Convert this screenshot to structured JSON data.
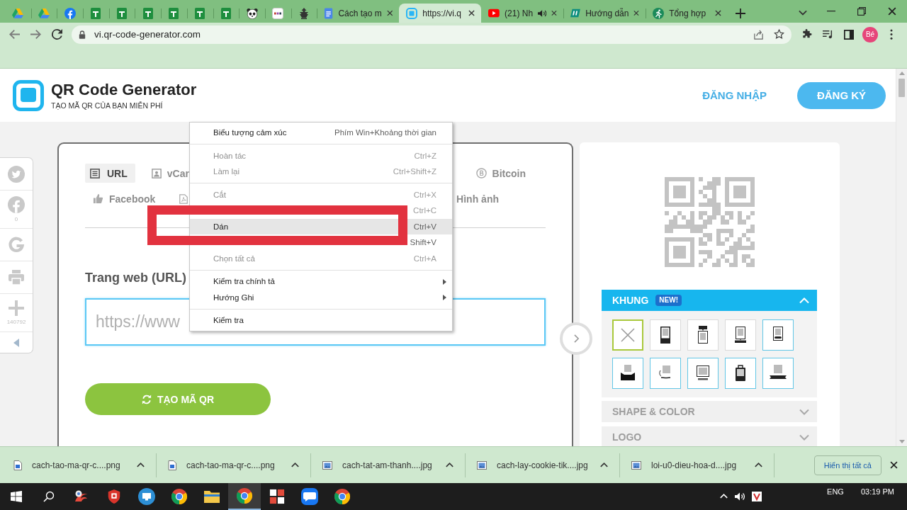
{
  "browser": {
    "tabs": [
      {
        "selected": false,
        "audio": false
      },
      {
        "selected": false,
        "audio": false
      },
      {
        "selected": false,
        "audio": false
      },
      {
        "selected": false,
        "audio": false
      },
      {
        "selected": false,
        "audio": false
      },
      {
        "selected": false,
        "audio": false
      },
      {
        "selected": false,
        "audio": false
      },
      {
        "selected": false,
        "audio": false
      },
      {
        "selected": false,
        "audio": false
      },
      {
        "selected": false,
        "audio": false
      },
      {
        "selected": false,
        "audio": false
      },
      {
        "selected": false,
        "audio": false
      },
      {
        "title": "Cách tạo m",
        "selected": false,
        "audio": false
      },
      {
        "title": "https://vi.q",
        "selected": true,
        "audio": false
      },
      {
        "title": "(21) Nh",
        "selected": false,
        "audio": true
      },
      {
        "title": "Hướng dẫn",
        "selected": false,
        "audio": false
      },
      {
        "title": "Tổng hợp",
        "selected": false,
        "audio": false
      }
    ],
    "address": "vi.qr-code-generator.com",
    "profile": "Bé"
  },
  "site": {
    "title": "QR Code Generator",
    "tagline": "TẠO MÃ QR CỦA BẠN MIỄN PHÍ",
    "login": "ĐĂNG NHẬP",
    "signup": "ĐĂNG KÝ"
  },
  "share_bar": [
    {
      "kind": "share"
    },
    {
      "kind": "share",
      "count": "0"
    },
    {
      "kind": "share"
    },
    {
      "kind": "share"
    },
    {
      "kind": "share",
      "count": "140792"
    },
    {
      "kind": "toggle"
    }
  ],
  "generator": {
    "types": [
      {
        "label": "URL",
        "selected": true
      },
      {
        "label": "vCar",
        "selected": false
      },
      {
        "label": "Bitcoin",
        "selected": false
      },
      {
        "label": "Facebook",
        "selected": false
      },
      {
        "selected": false
      },
      {
        "label": "Hình ảnh",
        "selected": false
      }
    ],
    "field_label": "Trang web (URL)",
    "url_field": {
      "placeholder": "https://www"
    },
    "submit": "TẠO MÃ QR"
  },
  "frames": {
    "title": "KHUNG",
    "badge": "NEW!",
    "expanded": true,
    "options": [
      {
        "kind": "none",
        "selected": true,
        "highlighted": false
      },
      {
        "kind": "frame",
        "selected": false,
        "highlighted": false
      },
      {
        "kind": "frame",
        "selected": false,
        "highlighted": false
      },
      {
        "kind": "frame",
        "selected": false,
        "highlighted": false
      },
      {
        "kind": "frame",
        "selected": false,
        "highlighted": true
      },
      {
        "kind": "frame",
        "selected": false,
        "highlighted": true
      },
      {
        "kind": "frame",
        "selected": false,
        "highlighted": true
      },
      {
        "kind": "frame",
        "selected": false,
        "highlighted": true
      },
      {
        "kind": "frame",
        "selected": false,
        "highlighted": true
      },
      {
        "kind": "frame",
        "selected": false,
        "highlighted": true
      }
    ]
  },
  "sections": [
    {
      "title": "SHAPE & COLOR",
      "expanded": false
    },
    {
      "title": "LOGO",
      "expanded": false
    }
  ],
  "context_menu": [
    {
      "kind": "item",
      "label": "Biểu tượng cảm xúc",
      "shortcut": "Phím Win+Khoảng thời gian",
      "disabled": false,
      "selected": false
    },
    {
      "kind": "separator"
    },
    {
      "kind": "item",
      "label": "Hoàn tác",
      "shortcut": "Ctrl+Z",
      "disabled": true,
      "selected": false
    },
    {
      "kind": "item",
      "label": "Làm lại",
      "shortcut": "Ctrl+Shift+Z",
      "disabled": true,
      "selected": false
    },
    {
      "kind": "separator"
    },
    {
      "kind": "item",
      "label": "Cắt",
      "shortcut": "Ctrl+X",
      "disabled": true,
      "selected": false
    },
    {
      "kind": "item",
      "shortcut": "Ctrl+C",
      "disabled": true,
      "selected": false
    },
    {
      "kind": "item",
      "label": "Dán",
      "shortcut": "Ctrl+V",
      "disabled": false,
      "selected": true
    },
    {
      "kind": "item",
      "shortcut": "Shift+V",
      "disabled": false,
      "selected": false
    },
    {
      "kind": "item",
      "label": "Chọn tất cả",
      "shortcut": "Ctrl+A",
      "disabled": true,
      "selected": false
    },
    {
      "kind": "separator"
    },
    {
      "kind": "submenu",
      "label": "Kiểm tra chính tả",
      "disabled": false,
      "selected": false
    },
    {
      "kind": "submenu",
      "label": "Hướng Ghi",
      "disabled": false,
      "selected": false
    },
    {
      "kind": "separator"
    },
    {
      "kind": "item",
      "label": "Kiểm tra",
      "disabled": false,
      "selected": false
    }
  ],
  "downloads": {
    "files": [
      {
        "kind": "document",
        "name": "cach-tao-ma-qr-c....png"
      },
      {
        "kind": "document",
        "name": "cach-tao-ma-qr-c....png"
      },
      {
        "kind": "image",
        "name": "cach-tat-am-thanh....jpg"
      },
      {
        "kind": "image",
        "name": "cach-lay-cookie-tik....jpg"
      },
      {
        "kind": "image",
        "name": "loi-u0-dieu-hoa-d....jpg"
      }
    ],
    "show_all": "Hiển thị tất cả"
  },
  "taskbar": {
    "apps": [
      {
        "active": false
      },
      {
        "active": false
      },
      {
        "active": false
      },
      {
        "active": false
      },
      {
        "active": false
      },
      {
        "active": true
      },
      {
        "active": false
      },
      {
        "active": false
      },
      {
        "active": false
      }
    ],
    "language": "ENG",
    "time": "03:19 PM"
  }
}
